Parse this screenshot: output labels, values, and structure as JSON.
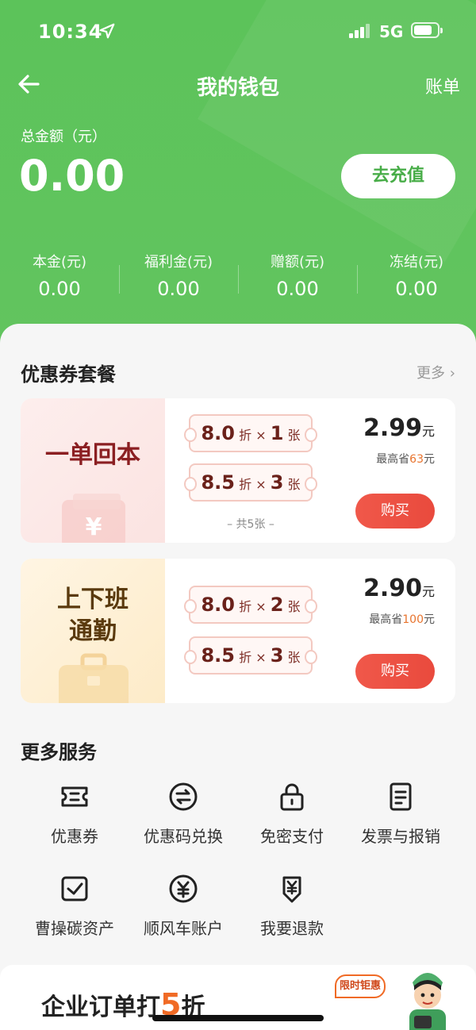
{
  "status_bar": {
    "time": "10:34",
    "network": "5G"
  },
  "nav": {
    "title": "我的钱包",
    "bill_label": "账单"
  },
  "balance": {
    "total_label": "总金额（元）",
    "total_value": "0.00",
    "recharge_label": "去充值",
    "breakdown": [
      {
        "label": "本金(元)",
        "value": "0.00"
      },
      {
        "label": "福利金(元)",
        "value": "0.00"
      },
      {
        "label": "赠额(元)",
        "value": "0.00"
      },
      {
        "label": "冻结(元)",
        "value": "0.00"
      }
    ]
  },
  "coupons": {
    "title": "优惠券套餐",
    "more_label": "更多",
    "packages": [
      {
        "name_lines": [
          "一单回本"
        ],
        "tickets": [
          {
            "discount": "8.0",
            "discount_unit": "折",
            "times": "×",
            "count": "1",
            "count_unit": "张"
          },
          {
            "discount": "8.5",
            "discount_unit": "折",
            "times": "×",
            "count": "3",
            "count_unit": "张"
          }
        ],
        "total": "– 共5张 –",
        "price": "2.99",
        "price_unit": "元",
        "save_prefix": "最高省",
        "save_amount": "63",
        "save_suffix": "元",
        "buy_label": "购买"
      },
      {
        "name_lines": [
          "上下班",
          "通勤"
        ],
        "tickets": [
          {
            "discount": "8.0",
            "discount_unit": "折",
            "times": "×",
            "count": "2",
            "count_unit": "张"
          },
          {
            "discount": "8.5",
            "discount_unit": "折",
            "times": "×",
            "count": "3",
            "count_unit": "张"
          }
        ],
        "price": "2.90",
        "price_unit": "元",
        "save_prefix": "最高省",
        "save_amount": "100",
        "save_suffix": "元",
        "buy_label": "购买"
      }
    ]
  },
  "services": {
    "title": "更多服务",
    "items": [
      {
        "label": "优惠券",
        "icon": "coupon-icon"
      },
      {
        "label": "优惠码兑换",
        "icon": "exchange-icon"
      },
      {
        "label": "免密支付",
        "icon": "lock-icon"
      },
      {
        "label": "发票与报销",
        "icon": "invoice-icon"
      },
      {
        "label": "曹操碳资产",
        "icon": "carbon-asset-icon"
      },
      {
        "label": "顺风车账户",
        "icon": "yuan-circle-icon"
      },
      {
        "label": "我要退款",
        "icon": "refund-icon"
      }
    ]
  },
  "promo": {
    "title_prefix": "企业订单打",
    "title_highlight": "5",
    "title_suffix": "折",
    "tag": "限时钜惠"
  },
  "colors": {
    "brand_green": "#5cc35a",
    "accent_orange": "#f06a25",
    "buy_red": "#ec5042"
  }
}
